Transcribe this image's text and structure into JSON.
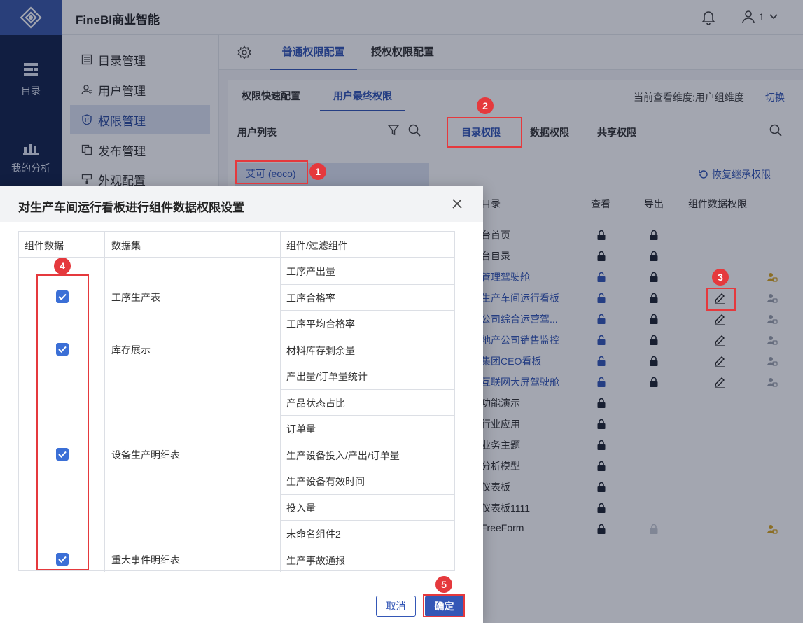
{
  "app": {
    "title": "FineBI商业智能",
    "user_name": "1"
  },
  "rail": {
    "items": [
      {
        "label": "目录"
      },
      {
        "label": "我的分析"
      }
    ]
  },
  "submenu": {
    "items": [
      {
        "label": "目录管理"
      },
      {
        "label": "用户管理"
      },
      {
        "label": "权限管理"
      },
      {
        "label": "发布管理"
      },
      {
        "label": "外观配置"
      }
    ]
  },
  "main_tabs": [
    {
      "label": "普通权限配置"
    },
    {
      "label": "授权权限配置"
    }
  ],
  "sub_tabs": [
    {
      "label": "权限快速配置"
    },
    {
      "label": "用户最终权限"
    }
  ],
  "dimension": {
    "text": "当前查看维度:用户组维度",
    "switch": "切换"
  },
  "user_list": {
    "title": "用户列表",
    "selected_user": "艾可 (eoco)"
  },
  "perm_tabs": [
    {
      "label": "目录权限"
    },
    {
      "label": "数据权限"
    },
    {
      "label": "共享权限"
    }
  ],
  "restore": {
    "label": "恢复继承权限"
  },
  "perm_table": {
    "headers": [
      "目录",
      "查看",
      "导出",
      "组件数据权限"
    ],
    "rows": [
      {
        "name": "台首页"
      },
      {
        "name": "台目录"
      },
      {
        "name": "管理驾驶舱"
      },
      {
        "name": "生产车间运行看板"
      },
      {
        "name": "公司综合运营驾..."
      },
      {
        "name": "地产公司销售监控"
      },
      {
        "name": "集团CEO看板"
      },
      {
        "name": "互联网大屏驾驶舱"
      },
      {
        "name": "功能演示"
      },
      {
        "name": "行业应用"
      },
      {
        "name": "业务主题"
      },
      {
        "name": "分析模型"
      },
      {
        "name": "仪表板"
      },
      {
        "name": "仪表板1111"
      },
      {
        "name": "FreeForm"
      }
    ]
  },
  "dialog": {
    "title": "对生产车间运行看板进行组件数据权限设置",
    "headers": [
      "组件数据",
      "数据集",
      "组件/过滤组件"
    ],
    "datasets": [
      {
        "name": "工序生产表",
        "checked": true,
        "components": [
          "工序产出量",
          "工序合格率",
          "工序平均合格率"
        ]
      },
      {
        "name": "库存展示",
        "checked": true,
        "components": [
          "材料库存剩余量"
        ]
      },
      {
        "name": "设备生产明细表",
        "checked": true,
        "components": [
          "产出量/订单量统计",
          "产品状态占比",
          "订单量",
          "生产设备投入/产出/订单量",
          "生产设备有效时间",
          "投入量",
          "未命名组件2"
        ]
      },
      {
        "name": "重大事件明细表",
        "checked": true,
        "components": [
          "生产事故通报"
        ]
      }
    ],
    "cancel": "取消",
    "ok": "确定"
  },
  "markers": [
    "1",
    "2",
    "3",
    "4",
    "5"
  ],
  "colors": {
    "accent": "#3457b6",
    "rail": "#14254d",
    "marker": "#e5393d",
    "checkbox": "#3b6fd6"
  }
}
